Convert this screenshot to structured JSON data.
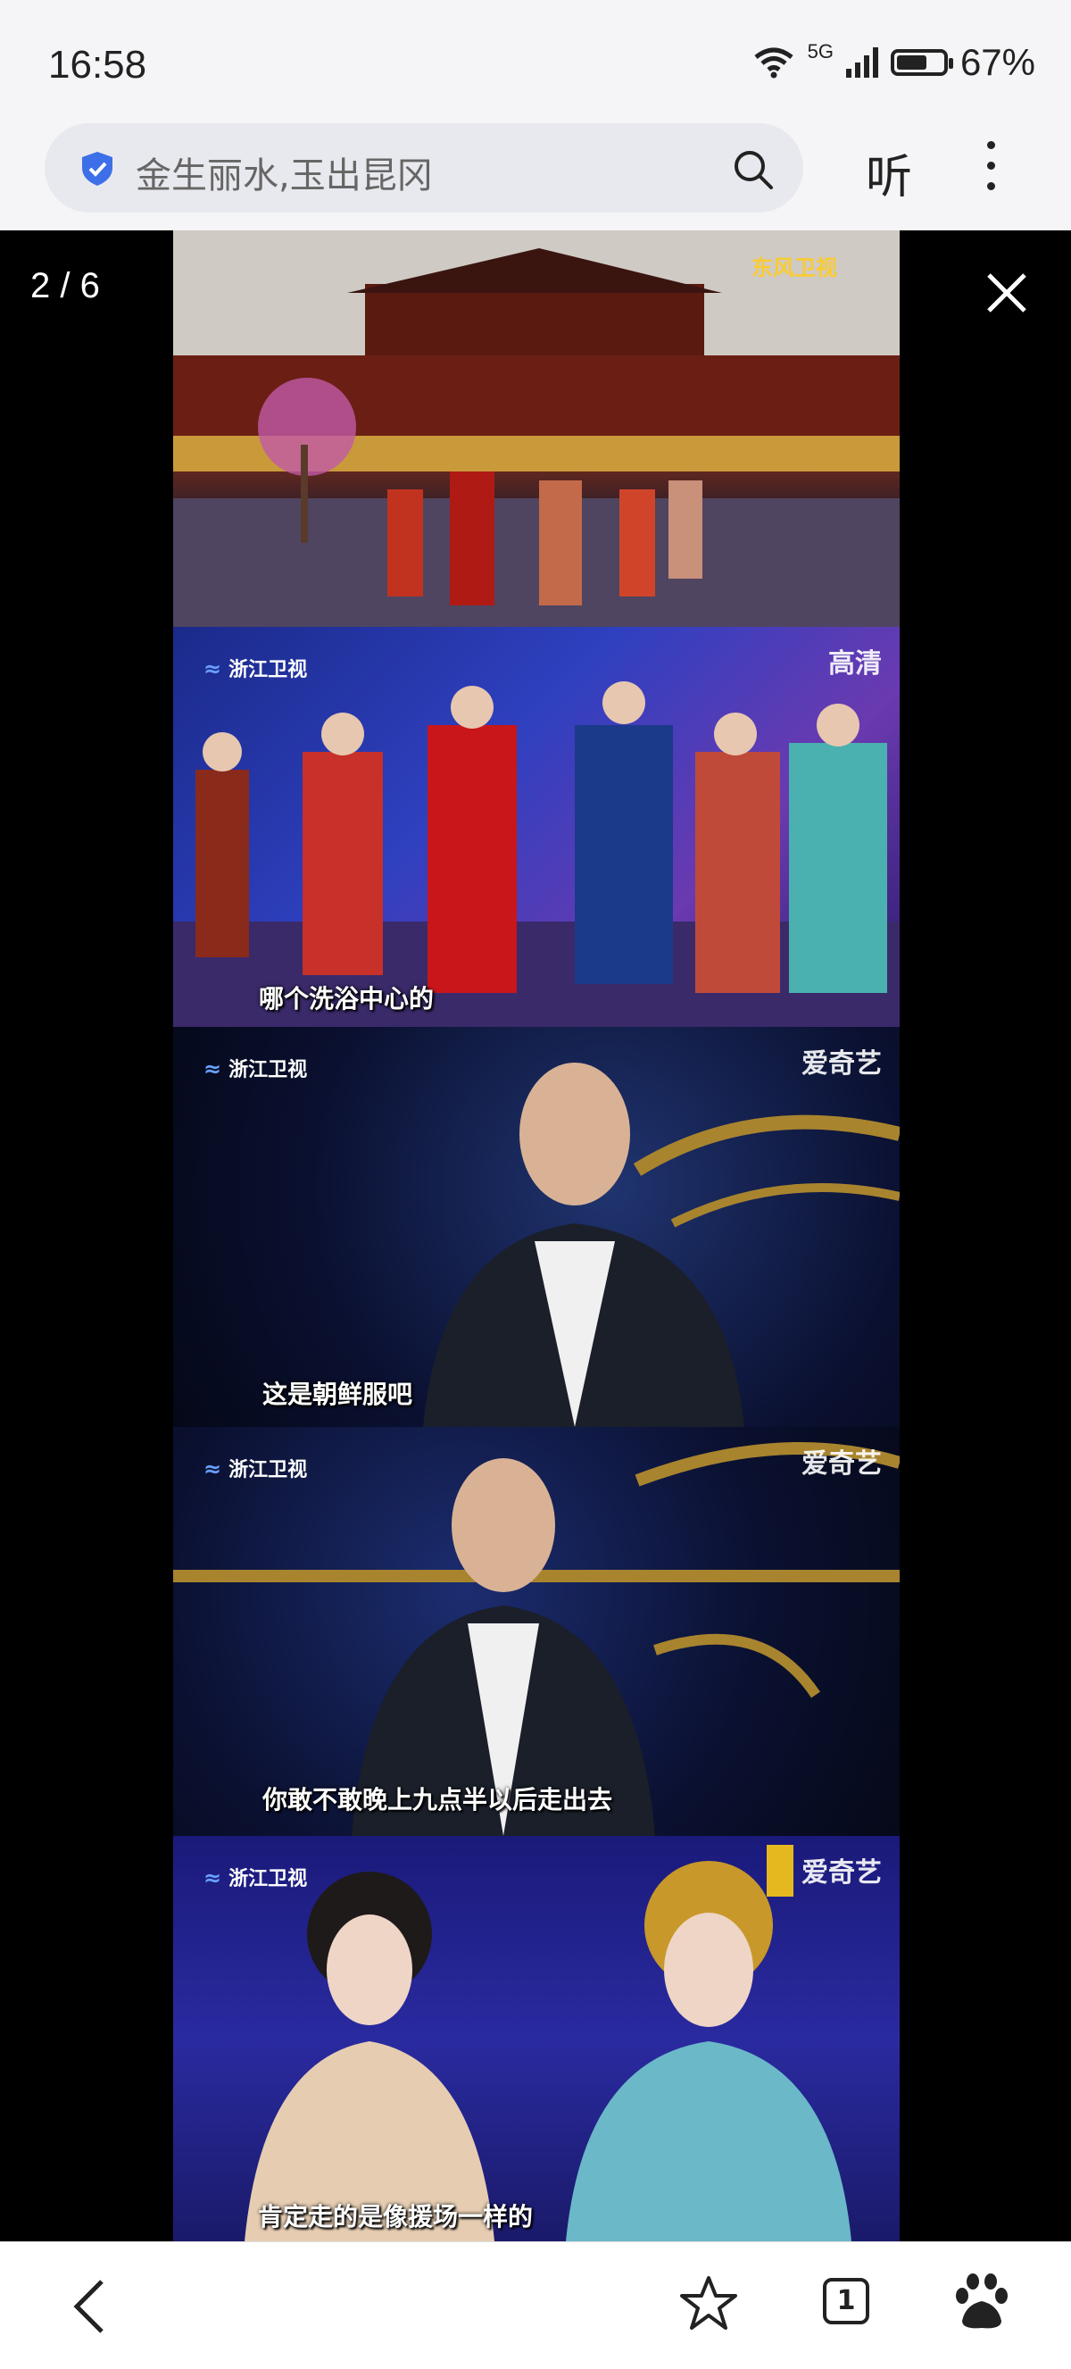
{
  "status": {
    "time": "16:58",
    "network": "5G",
    "battery_text": "67%",
    "battery_level": 0.67
  },
  "address_bar": {
    "query": "金生丽水,玉出昆冈",
    "listen_label": "听"
  },
  "viewer": {
    "counter": "2 / 6",
    "panels": [
      {
        "caption": "",
        "watermark_right": "东风卫视"
      },
      {
        "caption": "哪个洗浴中心的",
        "logo": "浙江卫视",
        "watermark_right": "高清"
      },
      {
        "caption": "这是朝鲜服吧",
        "logo": "浙江卫视",
        "watermark_right": "爱奇艺"
      },
      {
        "caption": "你敢不敢晚上九点半以后走出去",
        "logo": "浙江卫视",
        "watermark_right": "爱奇艺"
      },
      {
        "caption": "肯定走的是像援场一样的",
        "logo": "浙江卫视",
        "watermark_right": "爱奇艺"
      }
    ]
  },
  "bottom_nav": {
    "tabs_count": "1"
  },
  "icons": [
    "shield-icon",
    "search-icon",
    "more-icon",
    "close-icon",
    "back-icon",
    "star-icon",
    "tabs-icon",
    "baidu-icon"
  ]
}
